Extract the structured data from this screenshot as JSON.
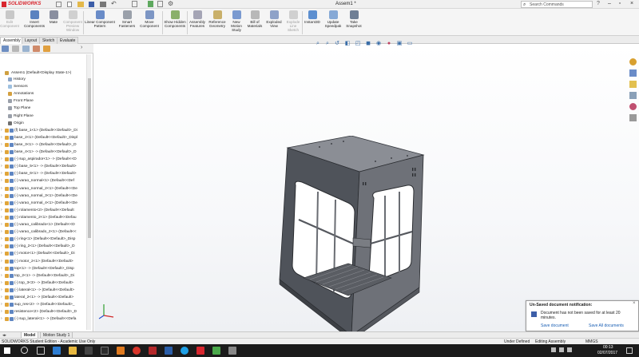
{
  "app": {
    "logo_text": "SOLIDWORKS",
    "doc_title": "Assem1 *",
    "search_placeholder": "Search Commands"
  },
  "ribbon": {
    "buttons": [
      {
        "label": "Edit Component",
        "enabled": false
      },
      {
        "label": "Insert Components",
        "enabled": true
      },
      {
        "label": "Mate",
        "enabled": true
      },
      {
        "label": "Component Preview Window",
        "enabled": false
      },
      {
        "label": "Linear Component Pattern",
        "enabled": true
      },
      {
        "label": "Smart Fasteners",
        "enabled": true
      },
      {
        "label": "Move Component",
        "enabled": true
      },
      {
        "label": "Show Hidden Components",
        "enabled": true
      },
      {
        "label": "Assembly Features",
        "enabled": true
      },
      {
        "label": "Reference Geometry",
        "enabled": true
      },
      {
        "label": "New Motion Study",
        "enabled": true
      },
      {
        "label": "Bill of Materials",
        "enabled": true
      },
      {
        "label": "Exploded View",
        "enabled": true
      },
      {
        "label": "Explode Line Sketch",
        "enabled": false
      },
      {
        "label": "Instant3D",
        "enabled": true
      },
      {
        "label": "Update Speedpak",
        "enabled": true
      },
      {
        "label": "Take Snapshot",
        "enabled": true
      }
    ]
  },
  "command_tabs": [
    "Assembly",
    "Layout",
    "Sketch",
    "Evaluate"
  ],
  "tree": {
    "root": "Assem1  (Default<Display State-1>)",
    "items": [
      "History",
      "Sensors",
      "Annotations",
      "Front Plane",
      "Top Plane",
      "Right Plane",
      "Origin",
      "(f) base_1<1> (Default<<Default>_Di",
      "base_2<1> (Default<<Default>_Displ",
      "base_3<1> -> (Default<<Default>_D",
      "base_4<1> -> (Default<<Default>_D",
      "(-) sup_aspirador<1> -> (Default<<D",
      "(-) base_5<1> -> (Default<<Default>",
      "(-) base_6<1> -> (Default<<Default>",
      "(-) varao_normal<1> (Default<<Def",
      "(-) varao_normal_2<1> (Default<<De",
      "(-) varao_normal_3<1> (Default<<De",
      "(-) varao_normal_4<1> (Default<<De",
      "(-) rolamento<2> (Default<<Default",
      "(-) rolamento_2<1> (Default<<Defau",
      "(-) varao_calibrado<1> (Default<<D",
      "(-) varao_calibrado_2<1> (Default<<",
      "(-) ring<1> (Default<<Default>_Disp",
      "(-) ring_2<1> (Default<<Default>_D",
      "(-) motor<1> (Default<<Default>_Di",
      "(-) motor_2<1> (Default<<Default>",
      "top<1> -> (Default<<Default>_Disp",
      "top_2<1> -> (Default<<Default>_Di",
      "(-) top_3<3> -> (Default<<Default>",
      "(-) lateral<1> -> (Default<<Default>",
      "lateral_2<1> -> (Default<<Default>",
      "sup_res<2> -> (Default<<Default>_",
      "resistence<2> (Default<<Default>_D",
      "(-) sup_lateral<1> -> (Default<<Defa"
    ]
  },
  "bottom_tabs": [
    "Model",
    "Motion Study 1"
  ],
  "status": {
    "left": "SOLIDWORKS Student Edition - Academic Use Only",
    "state1": "Under Defined",
    "state2": "Editing Assembly",
    "units": "MMGS"
  },
  "notification": {
    "title": "Un-Saved document notification:",
    "message": "Document has not been saved for at least 20 minutes.",
    "save_link": "Save document",
    "save_all_link": "Save All documents"
  },
  "taskbar": {
    "time": "00:13",
    "date": "02/07/2017"
  },
  "colors": {
    "brand_red": "#d8262e",
    "link_blue": "#1a5fb4",
    "model_gray": "#6e7178"
  }
}
